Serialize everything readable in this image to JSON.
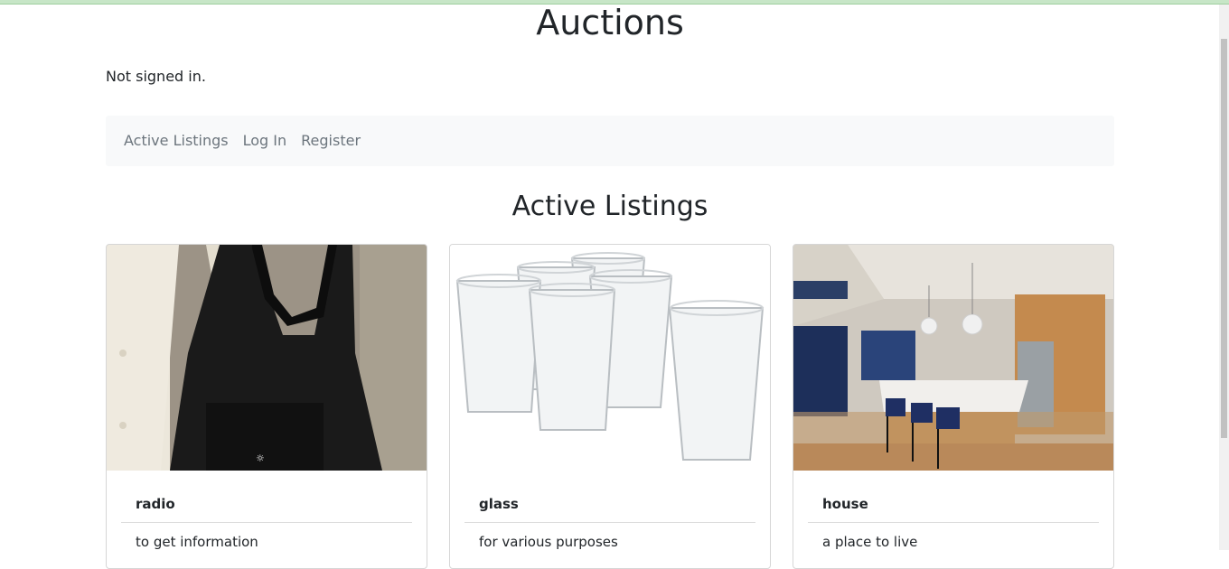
{
  "site": {
    "title": "Auctions",
    "signin_status": "Not signed in."
  },
  "nav": {
    "items": [
      {
        "label": "Active Listings"
      },
      {
        "label": "Log In"
      },
      {
        "label": "Register"
      }
    ]
  },
  "main": {
    "heading": "Active Listings"
  },
  "listings": [
    {
      "title": "radio",
      "description": "to get information",
      "image": "black-tote-bag"
    },
    {
      "title": "glass",
      "description": "for various purposes",
      "image": "drinking-glasses"
    },
    {
      "title": "house",
      "description": "a place to live",
      "image": "kitchen-interior"
    }
  ],
  "colors": {
    "navbar_bg": "#f8f9fa",
    "nav_text": "#6c757d",
    "text": "#212529",
    "accent_top": "#c7e6c7"
  }
}
